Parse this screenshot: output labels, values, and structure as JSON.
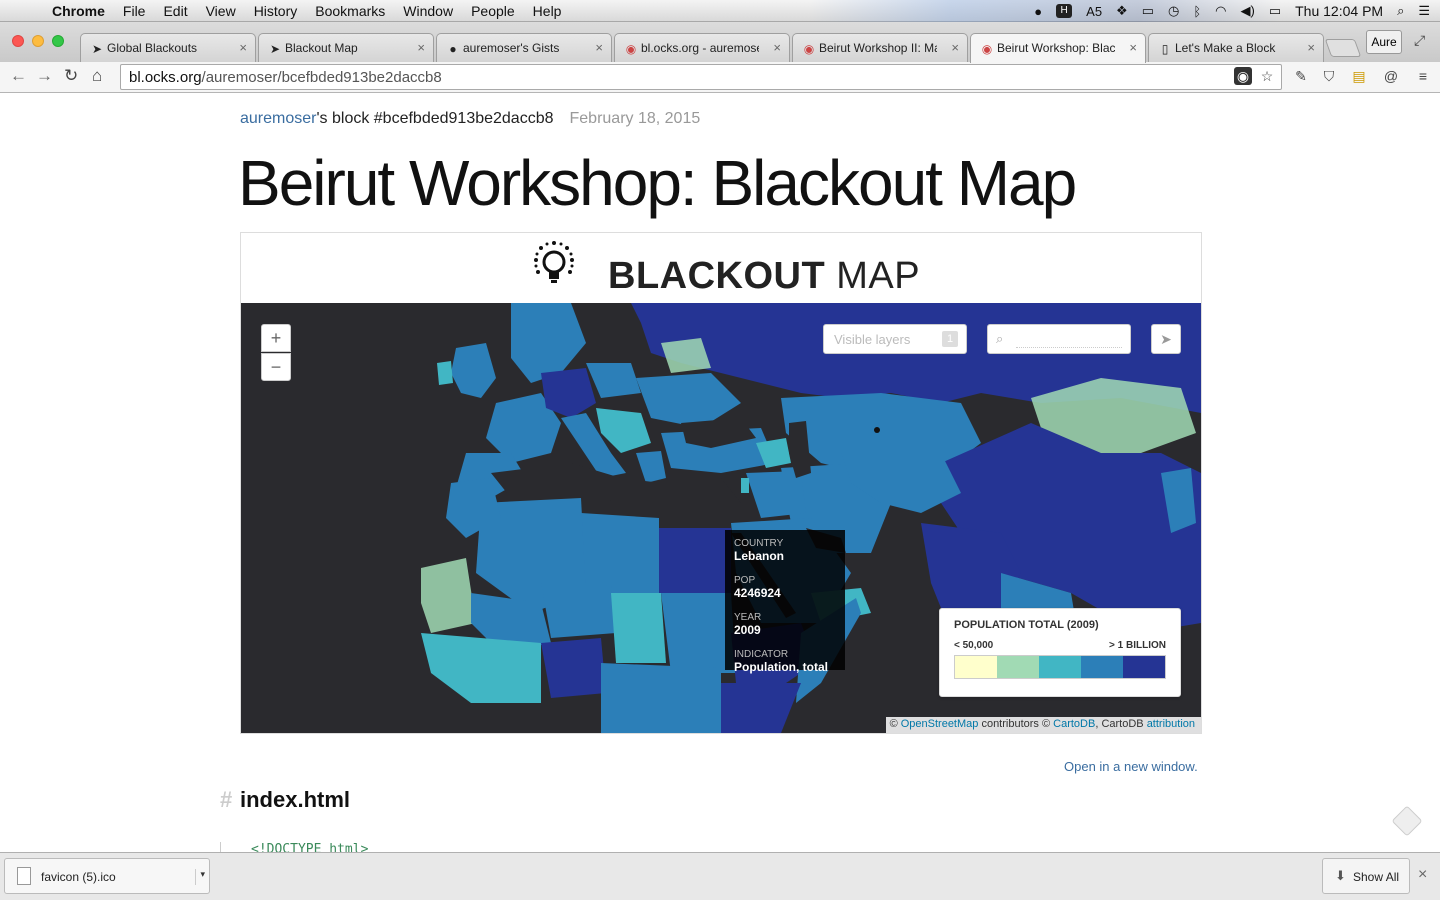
{
  "menubar": {
    "app": "Chrome",
    "items": [
      "File",
      "Edit",
      "View",
      "History",
      "Bookmarks",
      "Window",
      "People",
      "Help"
    ],
    "status_text": "5",
    "clock": "Thu 12:04 PM"
  },
  "tabs": [
    {
      "title": "Global Blackouts",
      "icon": "cursor-icon"
    },
    {
      "title": "Blackout Map",
      "icon": "cursor-icon"
    },
    {
      "title": "auremoser's Gists",
      "icon": "github-icon"
    },
    {
      "title": "bl.ocks.org - auremoser",
      "icon": "globe-icon"
    },
    {
      "title": "Beirut Workshop II: Map",
      "icon": "globe-icon"
    },
    {
      "title": "Beirut Workshop: Blackout Map",
      "icon": "globe-icon",
      "active": true
    },
    {
      "title": "Let's Make a Block",
      "icon": "page-icon"
    }
  ],
  "profile_label": "Aure",
  "address": {
    "host": "bl.ocks.org",
    "path": "/auremoser/bcefbded913be2daccb8"
  },
  "page": {
    "author": "auremoser",
    "byline_suffix": "'s block ",
    "gist_id": "#bcefbded913be2daccb8",
    "date": "February 18, 2015",
    "title": "Beirut Workshop: Blackout Map",
    "open_new_window": "Open in a new window.",
    "section_hash": "#",
    "section_title": "index.html",
    "code_peek": "<!DOCTYPE html>"
  },
  "map": {
    "heading_strong": "BLACKOUT",
    "heading_rest": " MAP",
    "zoom_in": "+",
    "zoom_out": "−",
    "layers_label": "Visible layers",
    "layers_count": "1",
    "search_placeholder": "",
    "tooltip": {
      "country_label": "COUNTRY",
      "country": "Lebanon",
      "pop_label": "POP",
      "pop": "4246924",
      "year_label": "YEAR",
      "year": "2009",
      "indicator_label": "INDICATOR",
      "indicator": "Population, total"
    },
    "legend": {
      "title": "POPULATION TOTAL (2009)",
      "min_label": "< 50,000",
      "max_label": "> 1 BILLION",
      "colors": [
        "#ffffcc",
        "#a1dab4",
        "#41b6c4",
        "#2c7fb8",
        "#253494"
      ]
    },
    "attribution": {
      "prefix": "© ",
      "osm": "OpenStreetMap",
      "middle": " contributors © ",
      "cartodb": "CartoDB",
      "middle2": ", CartoDB ",
      "attr_link": "attribution"
    }
  },
  "downloads": {
    "file": "favicon (5).ico",
    "show_all": "Show All"
  }
}
